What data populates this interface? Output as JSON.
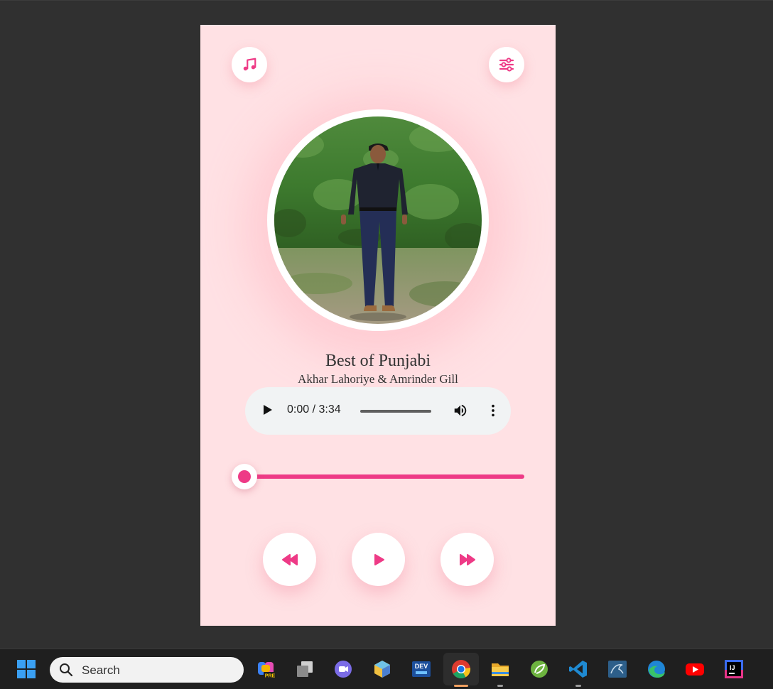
{
  "player": {
    "title": "Best of Punjabi",
    "artist": "Akhar Lahoriye & Amrinder Gill",
    "audio_time": "0:00 / 3:34",
    "progress_fraction": 0.0,
    "icons": {
      "music": "music-note-icon",
      "settings": "sliders-icon",
      "prev": "rewind-icon",
      "play": "play-icon",
      "next": "fast-forward-icon"
    },
    "colors": {
      "accent": "#ee3a86",
      "background": "#ffe1e4"
    }
  },
  "taskbar": {
    "search_label": "Search",
    "apps": [
      "windows-start-icon",
      "copilot-icon",
      "task-view-icon",
      "teams-icon",
      "app-cube-icon",
      "dev-home-icon",
      "chrome-icon",
      "file-explorer-icon",
      "spring-icon",
      "vscode-icon",
      "mysql-icon",
      "edge-icon",
      "youtube-icon",
      "intellij-icon"
    ],
    "dev_label": "DEV",
    "pre_label": "PRE",
    "ij_label": "IJ"
  }
}
